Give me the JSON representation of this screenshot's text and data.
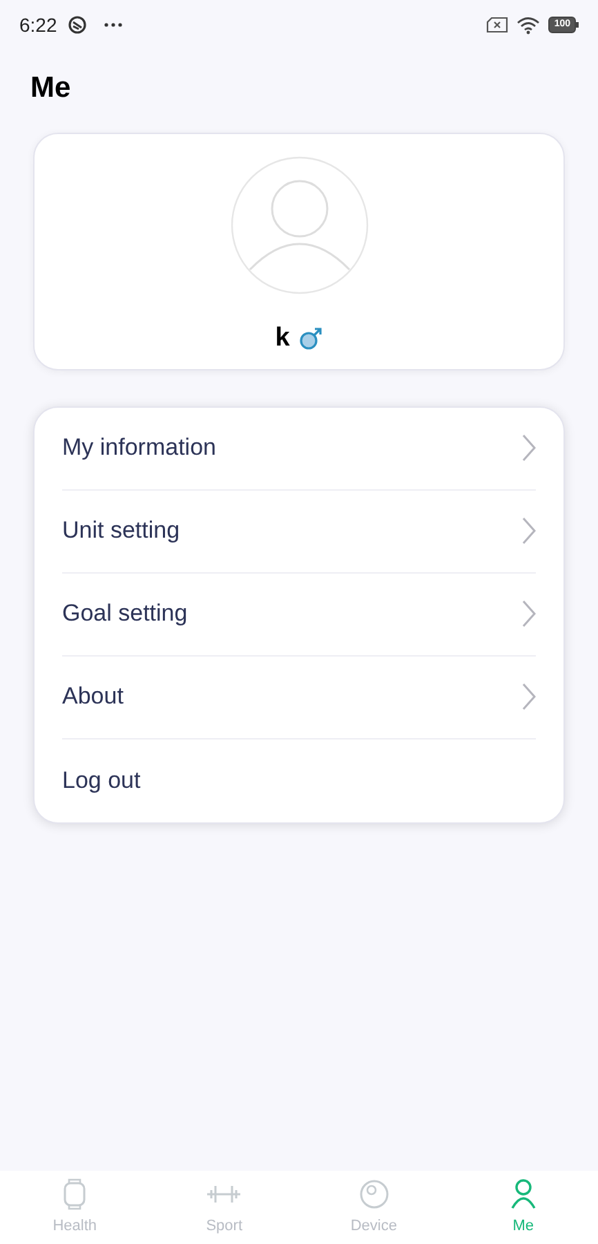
{
  "status_bar": {
    "time": "6:22",
    "battery": "100"
  },
  "title": "Me",
  "profile": {
    "name": "k",
    "male": true
  },
  "menu": [
    {
      "label": "My information",
      "chevron": true
    },
    {
      "label": "Unit setting",
      "chevron": true
    },
    {
      "label": "Goal setting",
      "chevron": true
    },
    {
      "label": "About",
      "chevron": true
    },
    {
      "label": "Log out",
      "chevron": false
    }
  ],
  "nav": [
    {
      "label": "Health",
      "kind": "watch",
      "selected": false
    },
    {
      "label": "Sport",
      "kind": "dumbbell",
      "selected": false
    },
    {
      "label": "Device",
      "kind": "device",
      "selected": false
    },
    {
      "label": "Me",
      "kind": "person",
      "selected": true
    }
  ]
}
